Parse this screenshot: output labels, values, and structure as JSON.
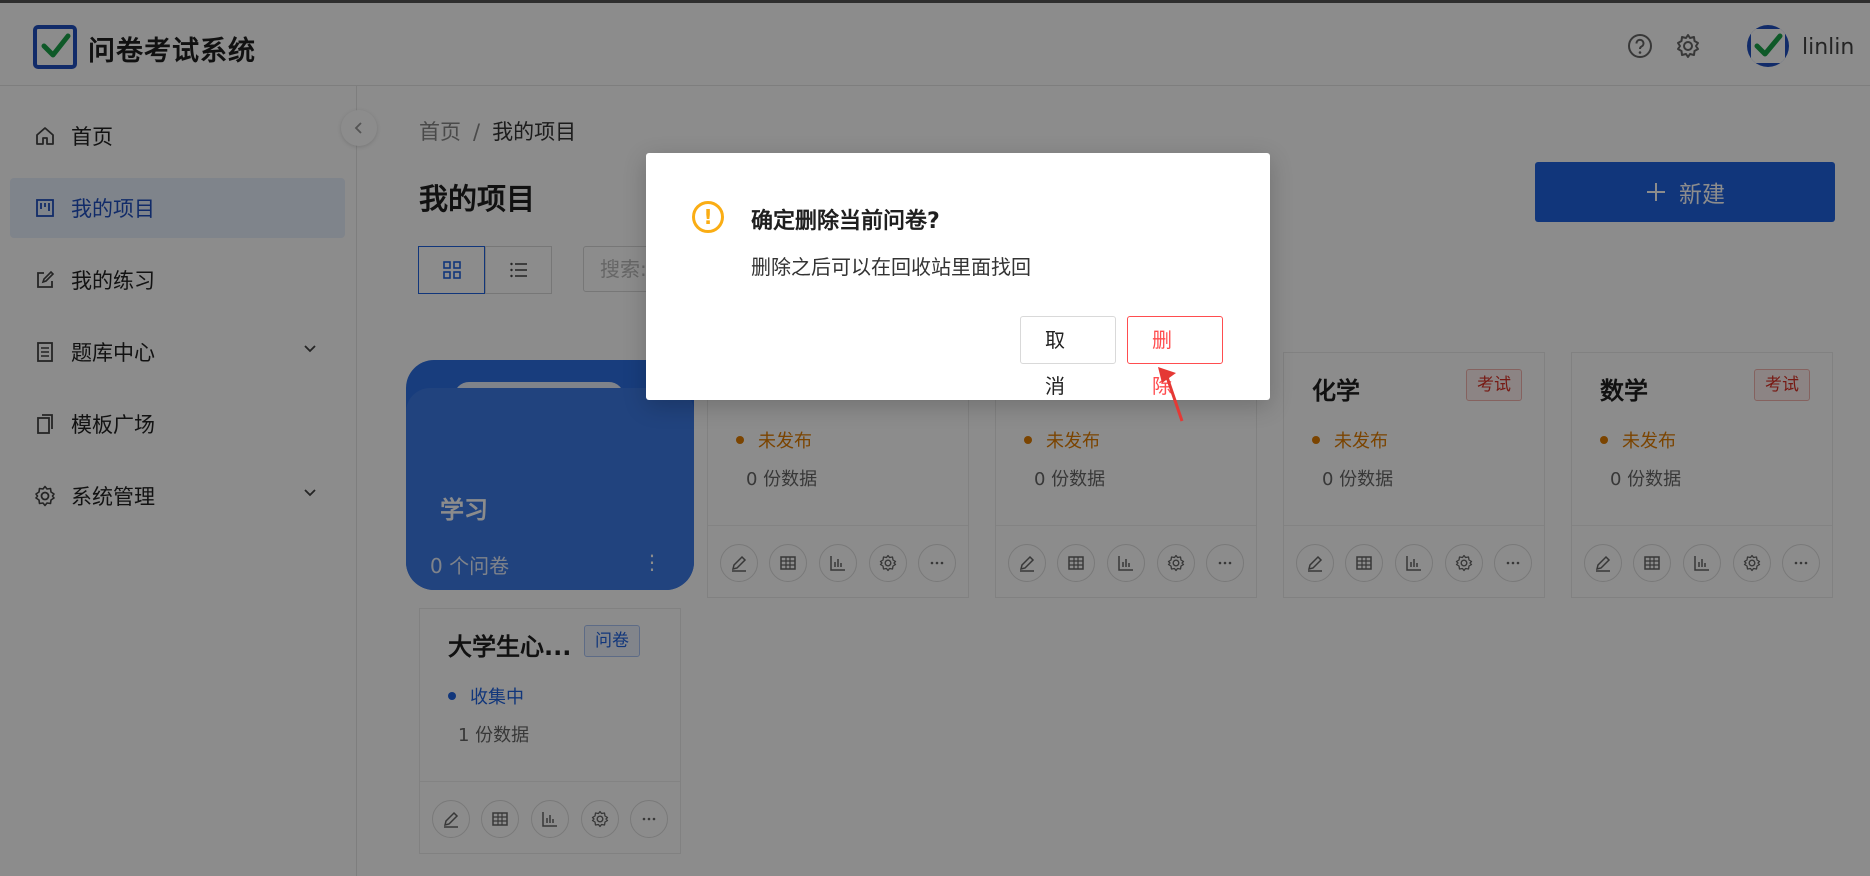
{
  "app": {
    "title": "问卷考试系统"
  },
  "header": {
    "username": "linlin",
    "icons": [
      "help-icon",
      "settings-icon"
    ]
  },
  "sidebar": {
    "items": [
      {
        "label": "首页",
        "icon": "home-icon",
        "active": false
      },
      {
        "label": "我的项目",
        "icon": "project-icon",
        "active": true
      },
      {
        "label": "我的练习",
        "icon": "edit-icon",
        "active": false
      },
      {
        "label": "题库中心",
        "icon": "library-icon",
        "active": false,
        "expandable": true
      },
      {
        "label": "模板广场",
        "icon": "template-icon",
        "active": false
      },
      {
        "label": "系统管理",
        "icon": "gear-icon",
        "active": false,
        "expandable": true
      }
    ]
  },
  "breadcrumb": {
    "home": "首页",
    "separator": "/",
    "current": "我的项目"
  },
  "main": {
    "title": "我的项目",
    "new_button": "新建",
    "search_placeholder": "搜索:"
  },
  "folder": {
    "title": "学习",
    "count": "0 个问卷",
    "more": "⋮"
  },
  "cards": [
    {
      "title": "",
      "tag": "",
      "status": "未发布",
      "data": "0  份数据"
    },
    {
      "title": "",
      "tag": "",
      "status": "未发布",
      "data": "0  份数据"
    },
    {
      "title": "化学",
      "tag": "考试",
      "status": "未发布",
      "data": "0  份数据"
    },
    {
      "title": "数学",
      "tag": "考试",
      "status": "未发布",
      "data": "0  份数据"
    },
    {
      "title": "大学生心...",
      "tag": "问卷",
      "status": "收集中",
      "data": "1  份数据"
    }
  ],
  "modal": {
    "title": "确定删除当前问卷?",
    "content": "删除之后可以在回收站里面找回",
    "cancel": "取 消",
    "confirm": "删 除"
  },
  "colors": {
    "primary": "#1f63e0",
    "danger": "#ff4d4f",
    "warning": "#faad14",
    "draft": "#e07c00"
  }
}
